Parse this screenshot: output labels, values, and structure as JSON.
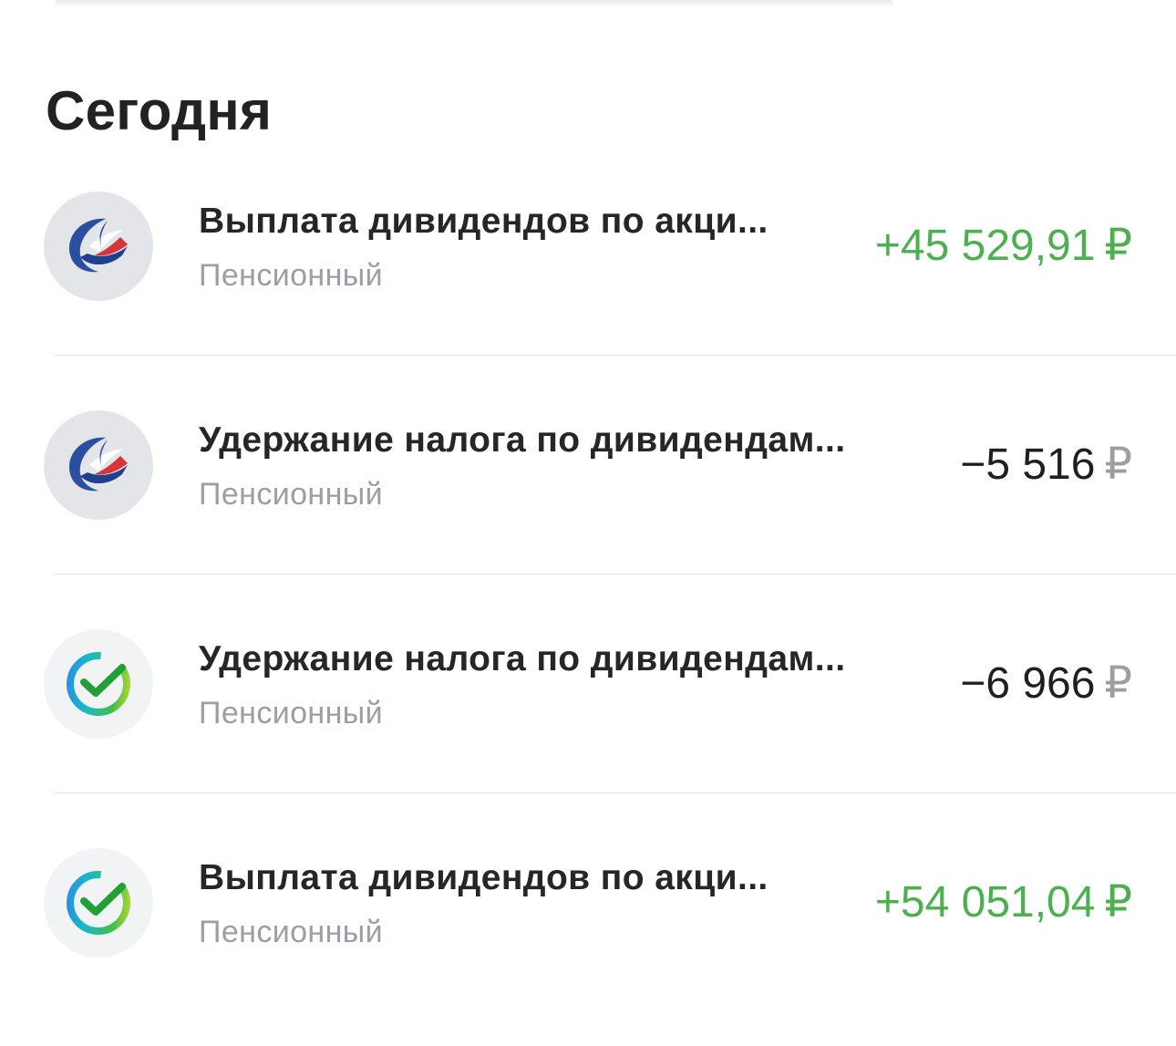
{
  "section": {
    "title": "Сегодня"
  },
  "colors": {
    "positive": "#4caf50",
    "negative": "#1f1f1f",
    "muted": "#9d9da3"
  },
  "transactions": [
    {
      "title": "Выплата дивидендов по акци...",
      "subtitle": "Пенсионный",
      "amount": "+45 529,91",
      "currency": "₽",
      "icon": "issuer-bird-logo-icon"
    },
    {
      "title": "Удержание налога по дивидендам...",
      "subtitle": "Пенсионный",
      "amount": "−5 516",
      "currency": "₽",
      "icon": "issuer-bird-logo-icon"
    },
    {
      "title": "Удержание налога по дивидендам...",
      "subtitle": "Пенсионный",
      "amount": "−6 966",
      "currency": "₽",
      "icon": "sber-check-logo-icon"
    },
    {
      "title": "Выплата дивидендов по акци...",
      "subtitle": "Пенсионный",
      "amount": "+54 051,04",
      "currency": "₽",
      "icon": "sber-check-logo-icon"
    }
  ]
}
